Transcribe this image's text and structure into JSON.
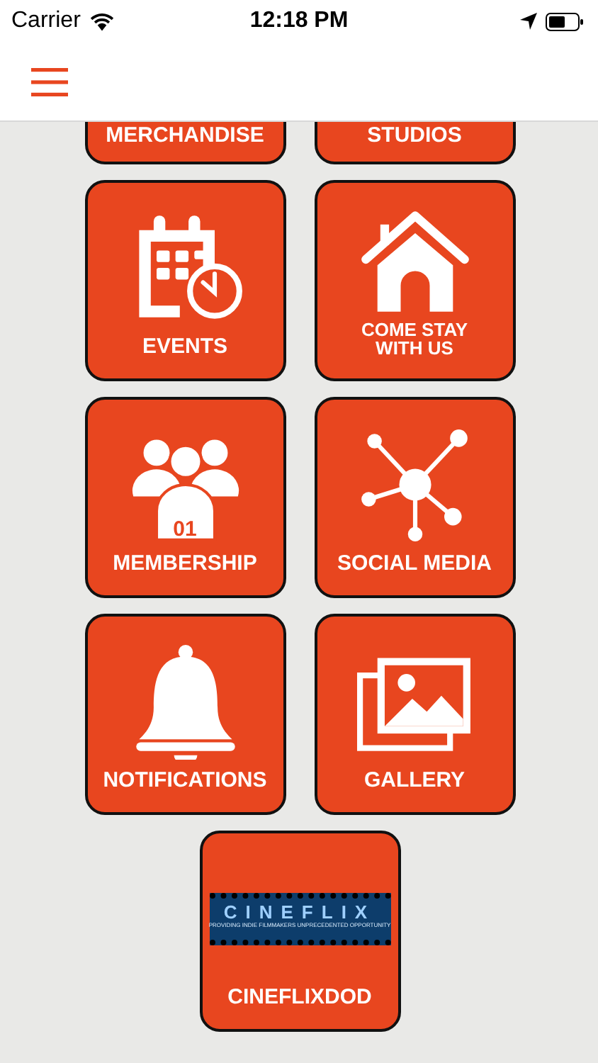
{
  "status_bar": {
    "carrier": "Carrier",
    "time": "12:18 PM"
  },
  "tiles": [
    {
      "label": "MERCHANDISE",
      "kind": "clipped"
    },
    {
      "label": "STUDIOS",
      "kind": "clipped"
    },
    {
      "label": "EVENTS",
      "kind": "calendar"
    },
    {
      "label": "COME STAY\nWITH US",
      "kind": "house"
    },
    {
      "label": "MEMBERSHIP",
      "kind": "people",
      "badge": "01"
    },
    {
      "label": "SOCIAL MEDIA",
      "kind": "network"
    },
    {
      "label": "NOTIFICATIONS",
      "kind": "bell"
    },
    {
      "label": "GALLERY",
      "kind": "gallery"
    },
    {
      "label": "CINEFLIXDOD",
      "kind": "logo",
      "logo_title": "CINEFLIX",
      "logo_tagline": "PROVIDING INDIE FILMMAKERS UNPRECEDENTED OPPORTUNITY"
    }
  ]
}
